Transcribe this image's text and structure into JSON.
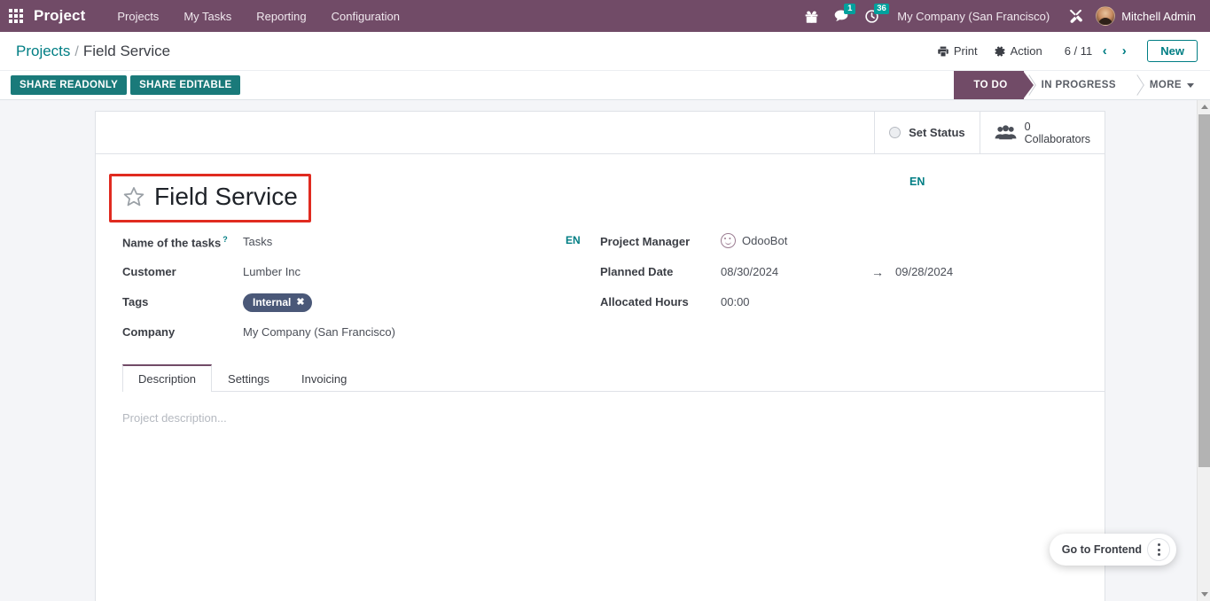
{
  "navbar": {
    "apps_icon": "apps-grid-icon",
    "brand": "Project",
    "menus": [
      {
        "label": "Projects"
      },
      {
        "label": "My Tasks"
      },
      {
        "label": "Reporting"
      },
      {
        "label": "Configuration"
      }
    ],
    "icons": {
      "gift": "gift-icon",
      "messages": "chat-bubble-icon",
      "activities": "clock-icon",
      "tools": "tools-icon"
    },
    "messages_count": "1",
    "activities_count": "36",
    "company": "My Company (San Francisco)",
    "user_name": "Mitchell Admin"
  },
  "control_panel": {
    "breadcrumb_root": "Projects",
    "breadcrumb_separator": "/",
    "breadcrumb_current": "Field Service",
    "print_label": "Print",
    "print_icon": "printer-icon",
    "action_label": "Action",
    "action_icon": "gear-icon",
    "pager": "6 / 11",
    "prev_icon": "chevron-left-icon",
    "next_icon": "chevron-right-icon",
    "new_label": "New",
    "share_readonly_label": "SHARE READONLY",
    "share_editable_label": "SHARE EDITABLE",
    "statusbar": [
      {
        "label": "TO DO",
        "active": true
      },
      {
        "label": "IN PROGRESS",
        "active": false
      },
      {
        "label": "MORE",
        "active": false,
        "has_caret": true
      }
    ]
  },
  "smart_buttons": {
    "set_status_label": "Set Status",
    "set_status_icon": "circle-icon",
    "collaborators_count": "0",
    "collaborators_label": "Collaborators",
    "collaborators_icon": "users-icon"
  },
  "record": {
    "star_icon": "star-outline-icon",
    "title": "Field Service",
    "title_lang": "EN"
  },
  "fields_left": {
    "name_of_tasks_label": "Name of the tasks",
    "name_of_tasks_help": "?",
    "name_of_tasks_value": "Tasks",
    "name_of_tasks_lang": "EN",
    "customer_label": "Customer",
    "customer_value": "Lumber Inc",
    "tags_label": "Tags",
    "tag_value": "Internal",
    "tag_remove_icon": "close-x-icon",
    "company_label": "Company",
    "company_value": "My Company (San Francisco)"
  },
  "fields_right": {
    "project_manager_label": "Project Manager",
    "project_manager_value": "OdooBot",
    "project_manager_avatar": "smiley-avatar-icon",
    "planned_date_label": "Planned Date",
    "planned_date_start": "08/30/2024",
    "planned_date_arrow": "→",
    "planned_date_end": "09/28/2024",
    "allocated_hours_label": "Allocated Hours",
    "allocated_hours_value": "00:00"
  },
  "tabs": [
    {
      "label": "Description",
      "active": true
    },
    {
      "label": "Settings",
      "active": false
    },
    {
      "label": "Invoicing",
      "active": false
    }
  ],
  "description": {
    "placeholder": "Project description..."
  },
  "frontend": {
    "label": "Go to Frontend",
    "menu_icon": "kebab-menu-icon"
  },
  "colors": {
    "brand_purple": "#714b67",
    "teal": "#017e84",
    "share_button_teal": "#1a7a7a",
    "tag_slate": "#4a5878",
    "highlight_red": "#e02b20",
    "badge_teal": "#00a09d"
  }
}
